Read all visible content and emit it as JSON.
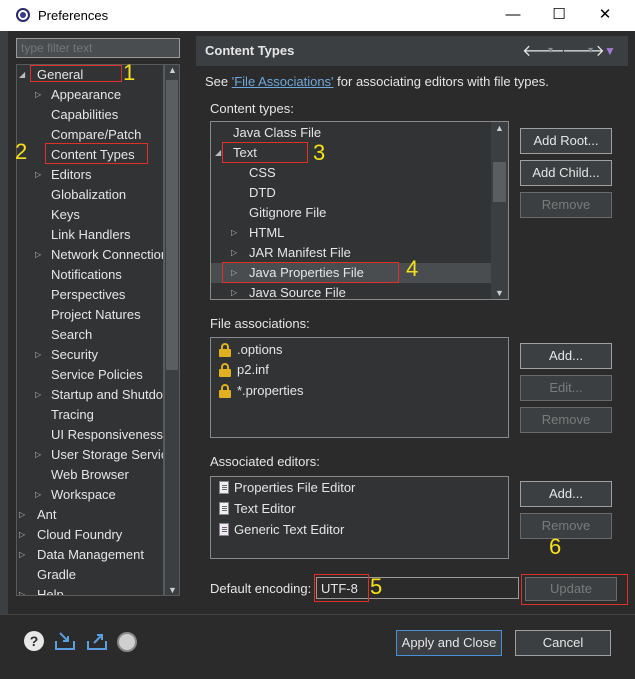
{
  "window": {
    "title": "Preferences",
    "min_glyph": "—",
    "max_glyph": "☐",
    "close_glyph": "✕"
  },
  "left": {
    "filter_placeholder": "type filter text",
    "tree": [
      {
        "label": "General",
        "expanded": true,
        "depth": 0
      },
      {
        "label": "Appearance",
        "expandable": true,
        "depth": 1
      },
      {
        "label": "Capabilities",
        "depth": 1
      },
      {
        "label": "Compare/Patch",
        "depth": 1
      },
      {
        "label": "Content Types",
        "depth": 1,
        "selected": true
      },
      {
        "label": "Editors",
        "expandable": true,
        "depth": 1
      },
      {
        "label": "Globalization",
        "depth": 1
      },
      {
        "label": "Keys",
        "depth": 1
      },
      {
        "label": "Link Handlers",
        "depth": 1
      },
      {
        "label": "Network Connection",
        "expandable": true,
        "depth": 1
      },
      {
        "label": "Notifications",
        "depth": 1
      },
      {
        "label": "Perspectives",
        "depth": 1
      },
      {
        "label": "Project Natures",
        "depth": 1
      },
      {
        "label": "Search",
        "depth": 1
      },
      {
        "label": "Security",
        "expandable": true,
        "depth": 1
      },
      {
        "label": "Service Policies",
        "depth": 1
      },
      {
        "label": "Startup and Shutdown",
        "expandable": true,
        "depth": 1
      },
      {
        "label": "Tracing",
        "depth": 1
      },
      {
        "label": "UI Responsiveness",
        "depth": 1
      },
      {
        "label": "User Storage Service",
        "expandable": true,
        "depth": 1
      },
      {
        "label": "Web Browser",
        "depth": 1
      },
      {
        "label": "Workspace",
        "expandable": true,
        "depth": 1
      },
      {
        "label": "Ant",
        "expandable": true,
        "depth": 0
      },
      {
        "label": "Cloud Foundry",
        "expandable": true,
        "depth": 0
      },
      {
        "label": "Data Management",
        "expandable": true,
        "depth": 0
      },
      {
        "label": "Gradle",
        "depth": 0
      },
      {
        "label": "Help",
        "expandable": true,
        "depth": 0
      }
    ]
  },
  "header": {
    "title": "Content Types"
  },
  "see": {
    "prefix": "See ",
    "link": "'File Associations'",
    "suffix": " for associating editors with file types."
  },
  "content_types": {
    "label": "Content types:",
    "items": [
      {
        "label": "Java Class File",
        "depth": 0
      },
      {
        "label": "Text",
        "depth": 0,
        "expanded": true
      },
      {
        "label": "CSS",
        "depth": 1
      },
      {
        "label": "DTD",
        "depth": 1
      },
      {
        "label": "Gitignore File",
        "depth": 1
      },
      {
        "label": "HTML",
        "depth": 1,
        "expandable": true
      },
      {
        "label": "JAR Manifest File",
        "depth": 1,
        "expandable": true
      },
      {
        "label": "Java Properties File",
        "depth": 1,
        "expandable": true,
        "selected": true
      },
      {
        "label": "Java Source File",
        "depth": 1,
        "expandable": true
      }
    ],
    "buttons": [
      "Add Root...",
      "Add Child...",
      "Remove"
    ]
  },
  "file_associations": {
    "label": "File associations:",
    "items": [
      ".options",
      "p2.inf",
      "*.properties"
    ],
    "buttons": [
      "Add...",
      "Edit...",
      "Remove"
    ]
  },
  "associated_editors": {
    "label": "Associated editors:",
    "items": [
      "Properties File Editor",
      "Text Editor",
      "Generic Text Editor"
    ],
    "buttons": [
      "Add...",
      "Remove"
    ]
  },
  "encoding": {
    "label": "Default encoding:",
    "value": "UTF-8",
    "update_label": "Update"
  },
  "footer": {
    "apply_close": "Apply and Close",
    "cancel": "Cancel"
  },
  "annotations": [
    "1",
    "2",
    "3",
    "4",
    "5",
    "6"
  ],
  "colors": {
    "annotation_box": "#e0302a",
    "annotation_number": "#f7e018",
    "link": "#6fa8dc",
    "selection": "#3c3f41"
  }
}
